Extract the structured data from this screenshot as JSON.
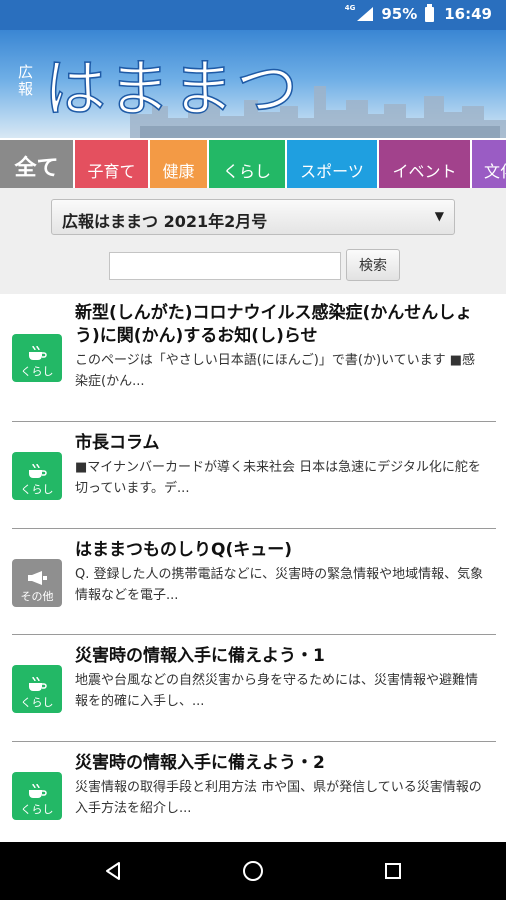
{
  "status_bar": {
    "network": "4G",
    "battery": "95%",
    "time": "16:49"
  },
  "header": {
    "logo_small": [
      "広",
      "報"
    ],
    "logo_main": "はままつ"
  },
  "tabs": [
    {
      "label": "全て",
      "color": "#8a8a8a"
    },
    {
      "label": "子育て",
      "color": "#e4505f"
    },
    {
      "label": "健康",
      "color": "#f39a45"
    },
    {
      "label": "くらし",
      "color": "#23b866"
    },
    {
      "label": "スポーツ",
      "color": "#1f9fe0"
    },
    {
      "label": "イベント",
      "color": "#a2428c"
    },
    {
      "label": "文化",
      "color": "#9a5cc4"
    }
  ],
  "filter": {
    "issue_selected": "広報はままつ 2021年2月号",
    "search_placeholder": "",
    "search_button": "検索"
  },
  "articles": [
    {
      "category": "くらし",
      "title": "新型(しんがた)コロナウイルス感染症(かんせんしょう)に関(かん)するお知(し)らせ",
      "desc": "このページは「やさしい日本語(にほんご)」で書(か)いています ■感染症(かん..."
    },
    {
      "category": "くらし",
      "title": "市長コラム",
      "desc": "■マイナンバーカードが導く未来社会 日本は急速にデジタル化に舵を切っています。デ..."
    },
    {
      "category": "その他",
      "title": "はままつものしりQ(キュー)",
      "desc": "Q. 登録した人の携帯電話などに、災害時の緊急情報や地域情報、気象情報などを電子..."
    },
    {
      "category": "くらし",
      "title": "災害時の情報入手に備えよう・1",
      "desc": "地震や台風などの自然災害から身を守るためには、災害情報や避難情報を的確に入手し、..."
    },
    {
      "category": "くらし",
      "title": "災害時の情報入手に備えよう・2",
      "desc": "災害情報の取得手段と利用方法 市や国、県が発信している災害情報の入手方法を紹介し..."
    }
  ]
}
